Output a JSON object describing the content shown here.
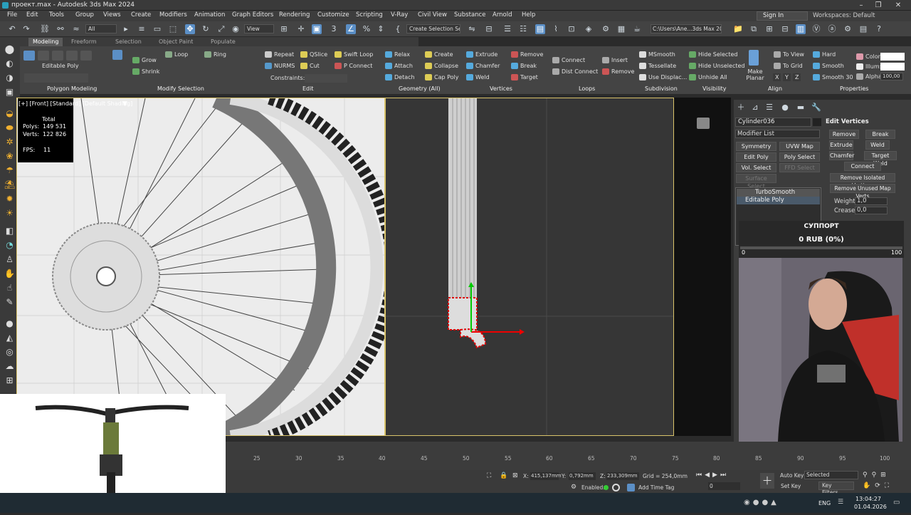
{
  "window": {
    "title": "проект.max - Autodesk 3ds Max 2024"
  },
  "menu": [
    "File",
    "Edit",
    "Tools",
    "Group",
    "Views",
    "Create",
    "Modifiers",
    "Animation",
    "Graph Editors",
    "Rendering",
    "Customize",
    "Scripting",
    "V-Ray",
    "Civil View",
    "Substance",
    "Arnold",
    "Help"
  ],
  "account": {
    "signin": "Sign In",
    "workspaces": "Workspaces: Default"
  },
  "toolbar": {
    "filter": "All",
    "view": "View",
    "selection_set": "Create Selection Se",
    "path": "C:\\Users\\Ane...3ds Max 2024"
  },
  "ribbon_tabs": [
    "Modeling",
    "Freeform",
    "Selection",
    "Object Paint",
    "Populate"
  ],
  "ribbon": {
    "editable_poly": "Editable Poly",
    "polygon_modeling": "Polygon Modeling",
    "grow": "Grow",
    "shrink": "Shrink",
    "loop": "Loop",
    "ring": "Ring",
    "modify_selection": "Modify Selection",
    "repeat": "Repeat",
    "qslice": "QSlice",
    "swift_loop": "Swift Loop",
    "nurms": "NURMS",
    "cut": "Cut",
    "p_connect": "P Connect",
    "constraints": "Constraints:",
    "edit": "Edit",
    "relax": "Relax",
    "create": "Create",
    "attach": "Attach",
    "collapse": "Collapse",
    "detach": "Detach",
    "cap_poly": "Cap Poly",
    "geometry": "Geometry (All)",
    "extrude": "Extrude",
    "remove": "Remove",
    "chamfer": "Chamfer",
    "break": "Break",
    "weld": "Weld",
    "target": "Target",
    "vertices": "Vertices",
    "connect": "Connect",
    "dist_connect": "Dist Connect",
    "insert": "Insert",
    "remove2": "Remove",
    "loops": "Loops",
    "msmooth": "MSmooth",
    "tessellate": "Tessellate",
    "use_displac": "Use Displac...",
    "subdivision": "Subdivision",
    "hide_selected": "Hide Selected",
    "hide_unselected": "Hide Unselected",
    "unhide_all": "Unhide All",
    "visibility": "Visibility",
    "make_planar": "Make Planar",
    "to_view": "To View",
    "to_grid": "To Grid",
    "x": "X",
    "y": "Y",
    "z": "Z",
    "align": "Align",
    "hard": "Hard",
    "smooth": "Smooth",
    "smooth30": "Smooth 30",
    "color": "Color:",
    "illum": "Illum:",
    "alpha": "Alpha:",
    "alpha_val": "100,00",
    "properties": "Properties"
  },
  "viewport": {
    "label": "[+] [Front] [Standard] [Default Shading]",
    "stats_total": "Total",
    "polys_label": "Polys:",
    "polys": "149 531",
    "verts_label": "Verts:",
    "verts": "122 826",
    "fps_label": "FPS:",
    "fps": "11"
  },
  "command_panel": {
    "object": "Cylinder036",
    "modifier_list": "Modifier List",
    "buttons": [
      "Symmetry",
      "UVW Map",
      "Edit Poly",
      "Poly Select",
      "Vol. Select",
      "FFD Select",
      "Surface Select"
    ],
    "stack": [
      "TurboSmooth",
      "Editable Poly"
    ],
    "rollout": "Edit Vertices",
    "remove": "Remove",
    "break": "Break",
    "extrude": "Extrude",
    "weld": "Weld",
    "chamfer": "Chamfer",
    "target_weld": "Target Weld",
    "connect": "Connect",
    "remove_isolated": "Remove Isolated Vertices",
    "remove_unused": "Remove Unused Map Verts",
    "weight_label": "Weight:",
    "weight": "1,0",
    "crease_label": "Crease:",
    "crease": "0,0"
  },
  "support": {
    "title": "СУППОРТ",
    "amount": "0 RUB (0%)",
    "min": "0",
    "max": "100"
  },
  "timeline": {
    "ticks": [
      "25",
      "30",
      "35",
      "40",
      "45",
      "50",
      "55",
      "60",
      "65",
      "70",
      "75",
      "80",
      "85",
      "90",
      "95",
      "100"
    ]
  },
  "status": {
    "x_label": "X:",
    "x": "415,137mm",
    "y_label": "Y:",
    "y": "0,792mm",
    "z_label": "Z:",
    "z": "233,309mm",
    "grid": "Grid = 254,0mm",
    "enabled": "Enabled:",
    "add_time_tag": "Add Time Tag",
    "auto_key": "Auto Key",
    "selected": "Selected",
    "set_key": "Set Key",
    "key_filters": "Key Filters...",
    "frame": "0"
  },
  "taskbar": {
    "lang": "ENG",
    "time": "13:04:27",
    "date": "01.04.2026"
  }
}
